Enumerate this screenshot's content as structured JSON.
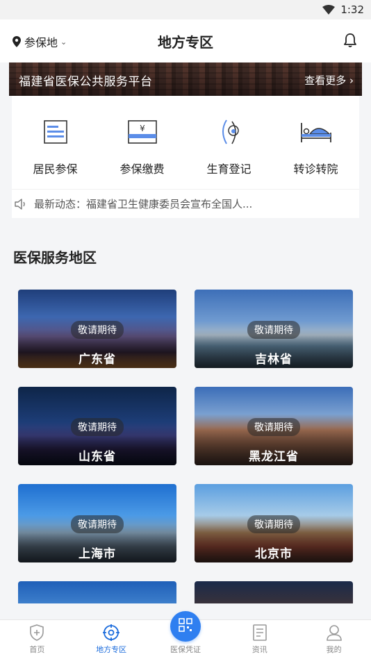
{
  "status_bar": {
    "time": "1:32"
  },
  "header": {
    "location_label": "参保地",
    "title": "地方专区"
  },
  "banner": {
    "title": "福建省医保公共服务平台",
    "more_label": "查看更多 ›"
  },
  "services": [
    {
      "label": "居民参保",
      "icon": "resident-insurance-icon"
    },
    {
      "label": "参保缴费",
      "icon": "payment-icon"
    },
    {
      "label": "生育登记",
      "icon": "birth-registration-icon"
    },
    {
      "label": "转诊转院",
      "icon": "hospital-transfer-icon"
    }
  ],
  "notice": {
    "text": "最新动态：福建省卫生健康委员会宣布全国人..."
  },
  "section": {
    "title": "医保服务地区"
  },
  "regions": [
    {
      "name": "广东省",
      "badge": "敬请期待"
    },
    {
      "name": "吉林省",
      "badge": "敬请期待"
    },
    {
      "name": "山东省",
      "badge": "敬请期待"
    },
    {
      "name": "黑龙江省",
      "badge": "敬请期待"
    },
    {
      "name": "上海市",
      "badge": "敬请期待"
    },
    {
      "name": "北京市",
      "badge": "敬请期待"
    }
  ],
  "tabbar": {
    "items": [
      {
        "label": "首页"
      },
      {
        "label": "地方专区"
      },
      {
        "label": "医保凭证"
      },
      {
        "label": "资讯"
      },
      {
        "label": "我的"
      }
    ],
    "active_color": "#1a6bdc",
    "accent": "#2f7ff0"
  }
}
